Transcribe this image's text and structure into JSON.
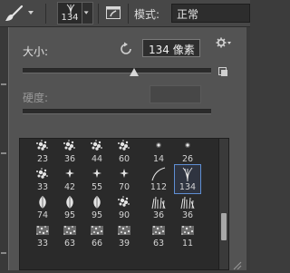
{
  "toolbar": {
    "tool_icon": "brush-tool-icon",
    "brush_size": "134",
    "mode_label": "模式:",
    "mode_value": "正常"
  },
  "panel": {
    "size_label": "大小:",
    "size_value": "134 像素",
    "size_slider_fraction": 0.59,
    "hardness_label": "硬度:",
    "hardness_value": "",
    "hardness_slider_fraction": null
  },
  "presets": [
    {
      "size": "23",
      "kind": "splatter"
    },
    {
      "size": "36",
      "kind": "splatter"
    },
    {
      "size": "44",
      "kind": "splatter"
    },
    {
      "size": "60",
      "kind": "splatter"
    },
    {
      "size": "14",
      "kind": "dot"
    },
    {
      "size": "26",
      "kind": "dot"
    },
    {
      "size": "33",
      "kind": "splatter"
    },
    {
      "size": "42",
      "kind": "star"
    },
    {
      "size": "55",
      "kind": "star"
    },
    {
      "size": "70",
      "kind": "star"
    },
    {
      "size": "112",
      "kind": "curve"
    },
    {
      "size": "134",
      "kind": "fan",
      "selected": true
    },
    {
      "size": "74",
      "kind": "leaf"
    },
    {
      "size": "95",
      "kind": "leaf"
    },
    {
      "size": "95",
      "kind": "leaf"
    },
    {
      "size": "90",
      "kind": "splatter"
    },
    {
      "size": "36",
      "kind": "grass"
    },
    {
      "size": "36",
      "kind": "grass"
    },
    {
      "size": "33",
      "kind": "texture"
    },
    {
      "size": "63",
      "kind": "texture"
    },
    {
      "size": "66",
      "kind": "texture"
    },
    {
      "size": "39",
      "kind": "texture"
    },
    {
      "size": "63",
      "kind": "texture"
    },
    {
      "size": "11",
      "kind": "texture"
    }
  ]
}
